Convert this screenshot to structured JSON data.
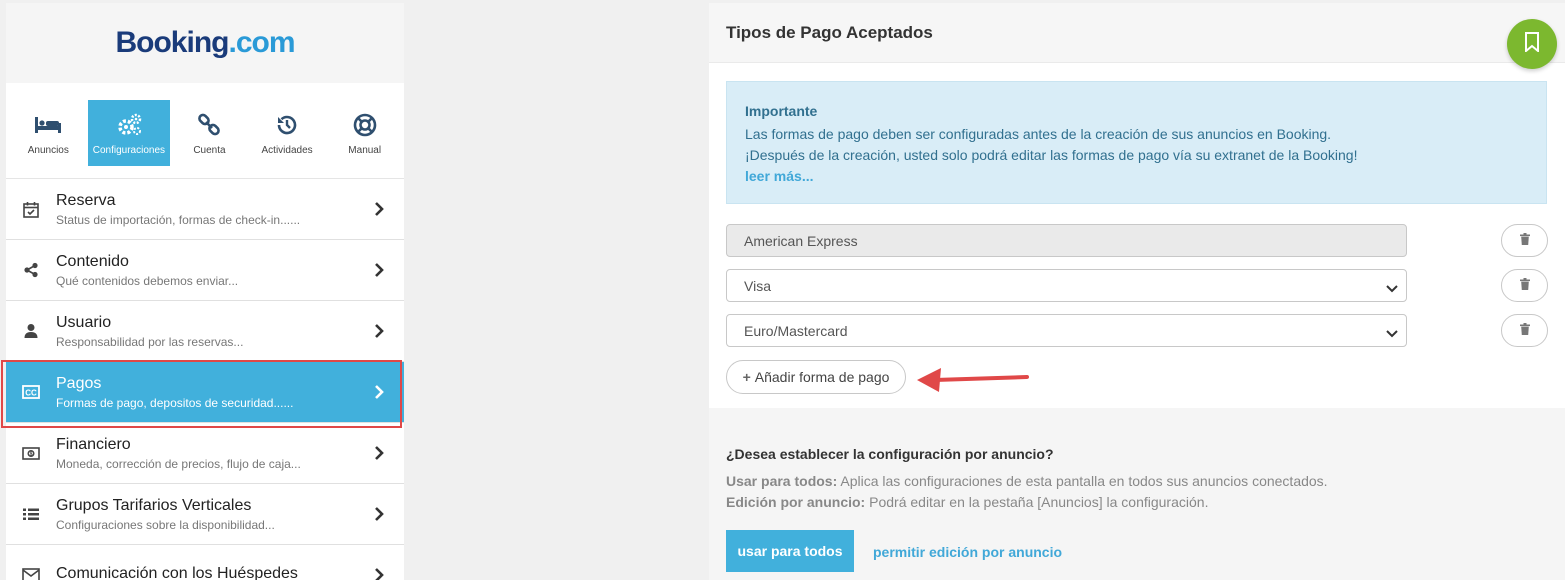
{
  "sidebar": {
    "logo": {
      "part1": "Booking",
      "part2": ".com"
    },
    "topnav": [
      {
        "label": "Anuncios",
        "icon": "bed-icon"
      },
      {
        "label": "Configuraciones",
        "icon": "gears-icon"
      },
      {
        "label": "Cuenta",
        "icon": "link-icon"
      },
      {
        "label": "Actividades",
        "icon": "history-icon"
      },
      {
        "label": "Manual",
        "icon": "lifebuoy-icon"
      }
    ],
    "items": [
      {
        "title": "Reserva",
        "subtitle": "Status de importación, formas de check-in......",
        "icon": "calendar-check-icon"
      },
      {
        "title": "Contenido",
        "subtitle": "Qué contenidos debemos enviar...",
        "icon": "share-icon"
      },
      {
        "title": "Usuario",
        "subtitle": "Responsabilidad por las reservas...",
        "icon": "user-icon"
      },
      {
        "title": "Pagos",
        "subtitle": "Formas de pago, depositos de securidad......",
        "icon": "credit-card-icon"
      },
      {
        "title": "Financiero",
        "subtitle": "Moneda, corrección de precios, flujo de caja...",
        "icon": "money-icon"
      },
      {
        "title": "Grupos Tarifarios Verticales",
        "subtitle": "Configuraciones sobre la disponibilidad...",
        "icon": "list-icon"
      },
      {
        "title": "Comunicación con los Huéspedes",
        "subtitle": "",
        "icon": "envelope-icon"
      }
    ]
  },
  "panel": {
    "title": "Tipos de Pago Aceptados",
    "alert": {
      "title": "Importante",
      "line1": "Las formas de pago deben ser configuradas antes de la creación de sus anuncios en Booking.",
      "line2": "¡Después de la creación, usted solo podrá editar las formas de pago vía su extranet de la Booking!",
      "link": "leer más..."
    },
    "payment_methods": [
      {
        "value": "American Express",
        "editable": false
      },
      {
        "value": "Visa",
        "editable": true
      },
      {
        "value": "Euro/Mastercard",
        "editable": true
      }
    ],
    "add_button": "Añadir forma de pago",
    "bottom": {
      "question": "¿Desea establecer la configuración por anuncio?",
      "line1_bold": "Usar para todos:",
      "line1_text": " Aplica las configuraciones de esta pantalla en todos sus anuncios conectados.",
      "line2_bold": "Edición por anuncio:",
      "line2_text": " Podrá editar en la pestaña [Anuncios] la configuración.",
      "btn_all": "usar para todos",
      "btn_edit": "permitir edición por anuncio"
    }
  },
  "colors": {
    "accent": "#41b0dc",
    "bookmark": "#7cb82f",
    "highlight": "#e04848"
  }
}
